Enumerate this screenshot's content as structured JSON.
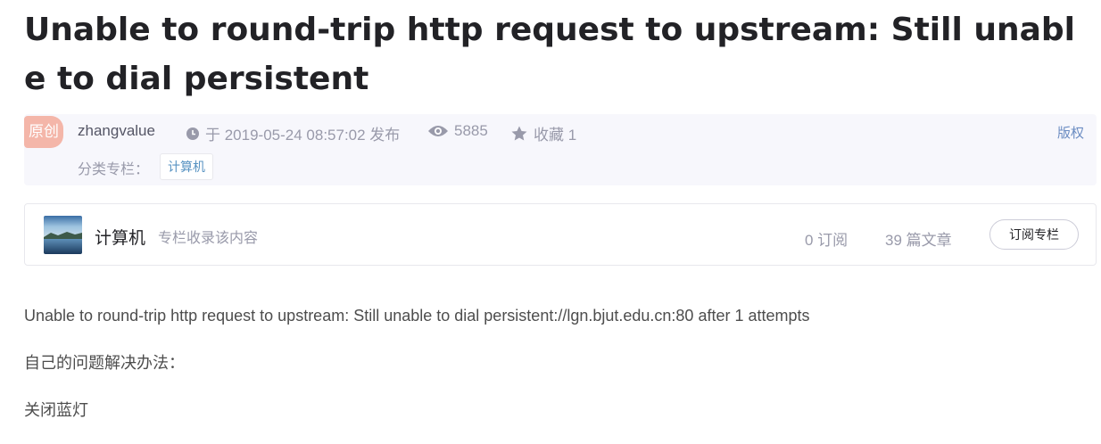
{
  "article": {
    "title": "Unable to round-trip http request to upstream: Still unable to dial persistent"
  },
  "info": {
    "badge": "原创",
    "author": "zhangvalue",
    "published": "于 2019-05-24 08:57:02 发布",
    "views": "5885",
    "favorites": "收藏 1",
    "copyright": "版权",
    "category_label": "分类专栏：",
    "category_tag": "计算机"
  },
  "column": {
    "name": "计算机",
    "description": "专栏收录该内容",
    "subscribers": "0 订阅",
    "articles": "39 篇文章",
    "subscribe_label": "订阅专栏"
  },
  "content": {
    "paragraphs": [
      "Unable to round-trip http request to upstream: Still unable to dial persistent://lgn.bjut.edu.cn:80 after 1 attempts",
      "自己的问题解决办法：",
      "关闭蓝灯"
    ]
  },
  "colors": {
    "badge_bg": "#f4b6a9",
    "link": "#5893c2",
    "meta_gray": "#999aaa"
  },
  "icons": [
    "clock-icon",
    "eye-icon",
    "star-icon"
  ]
}
